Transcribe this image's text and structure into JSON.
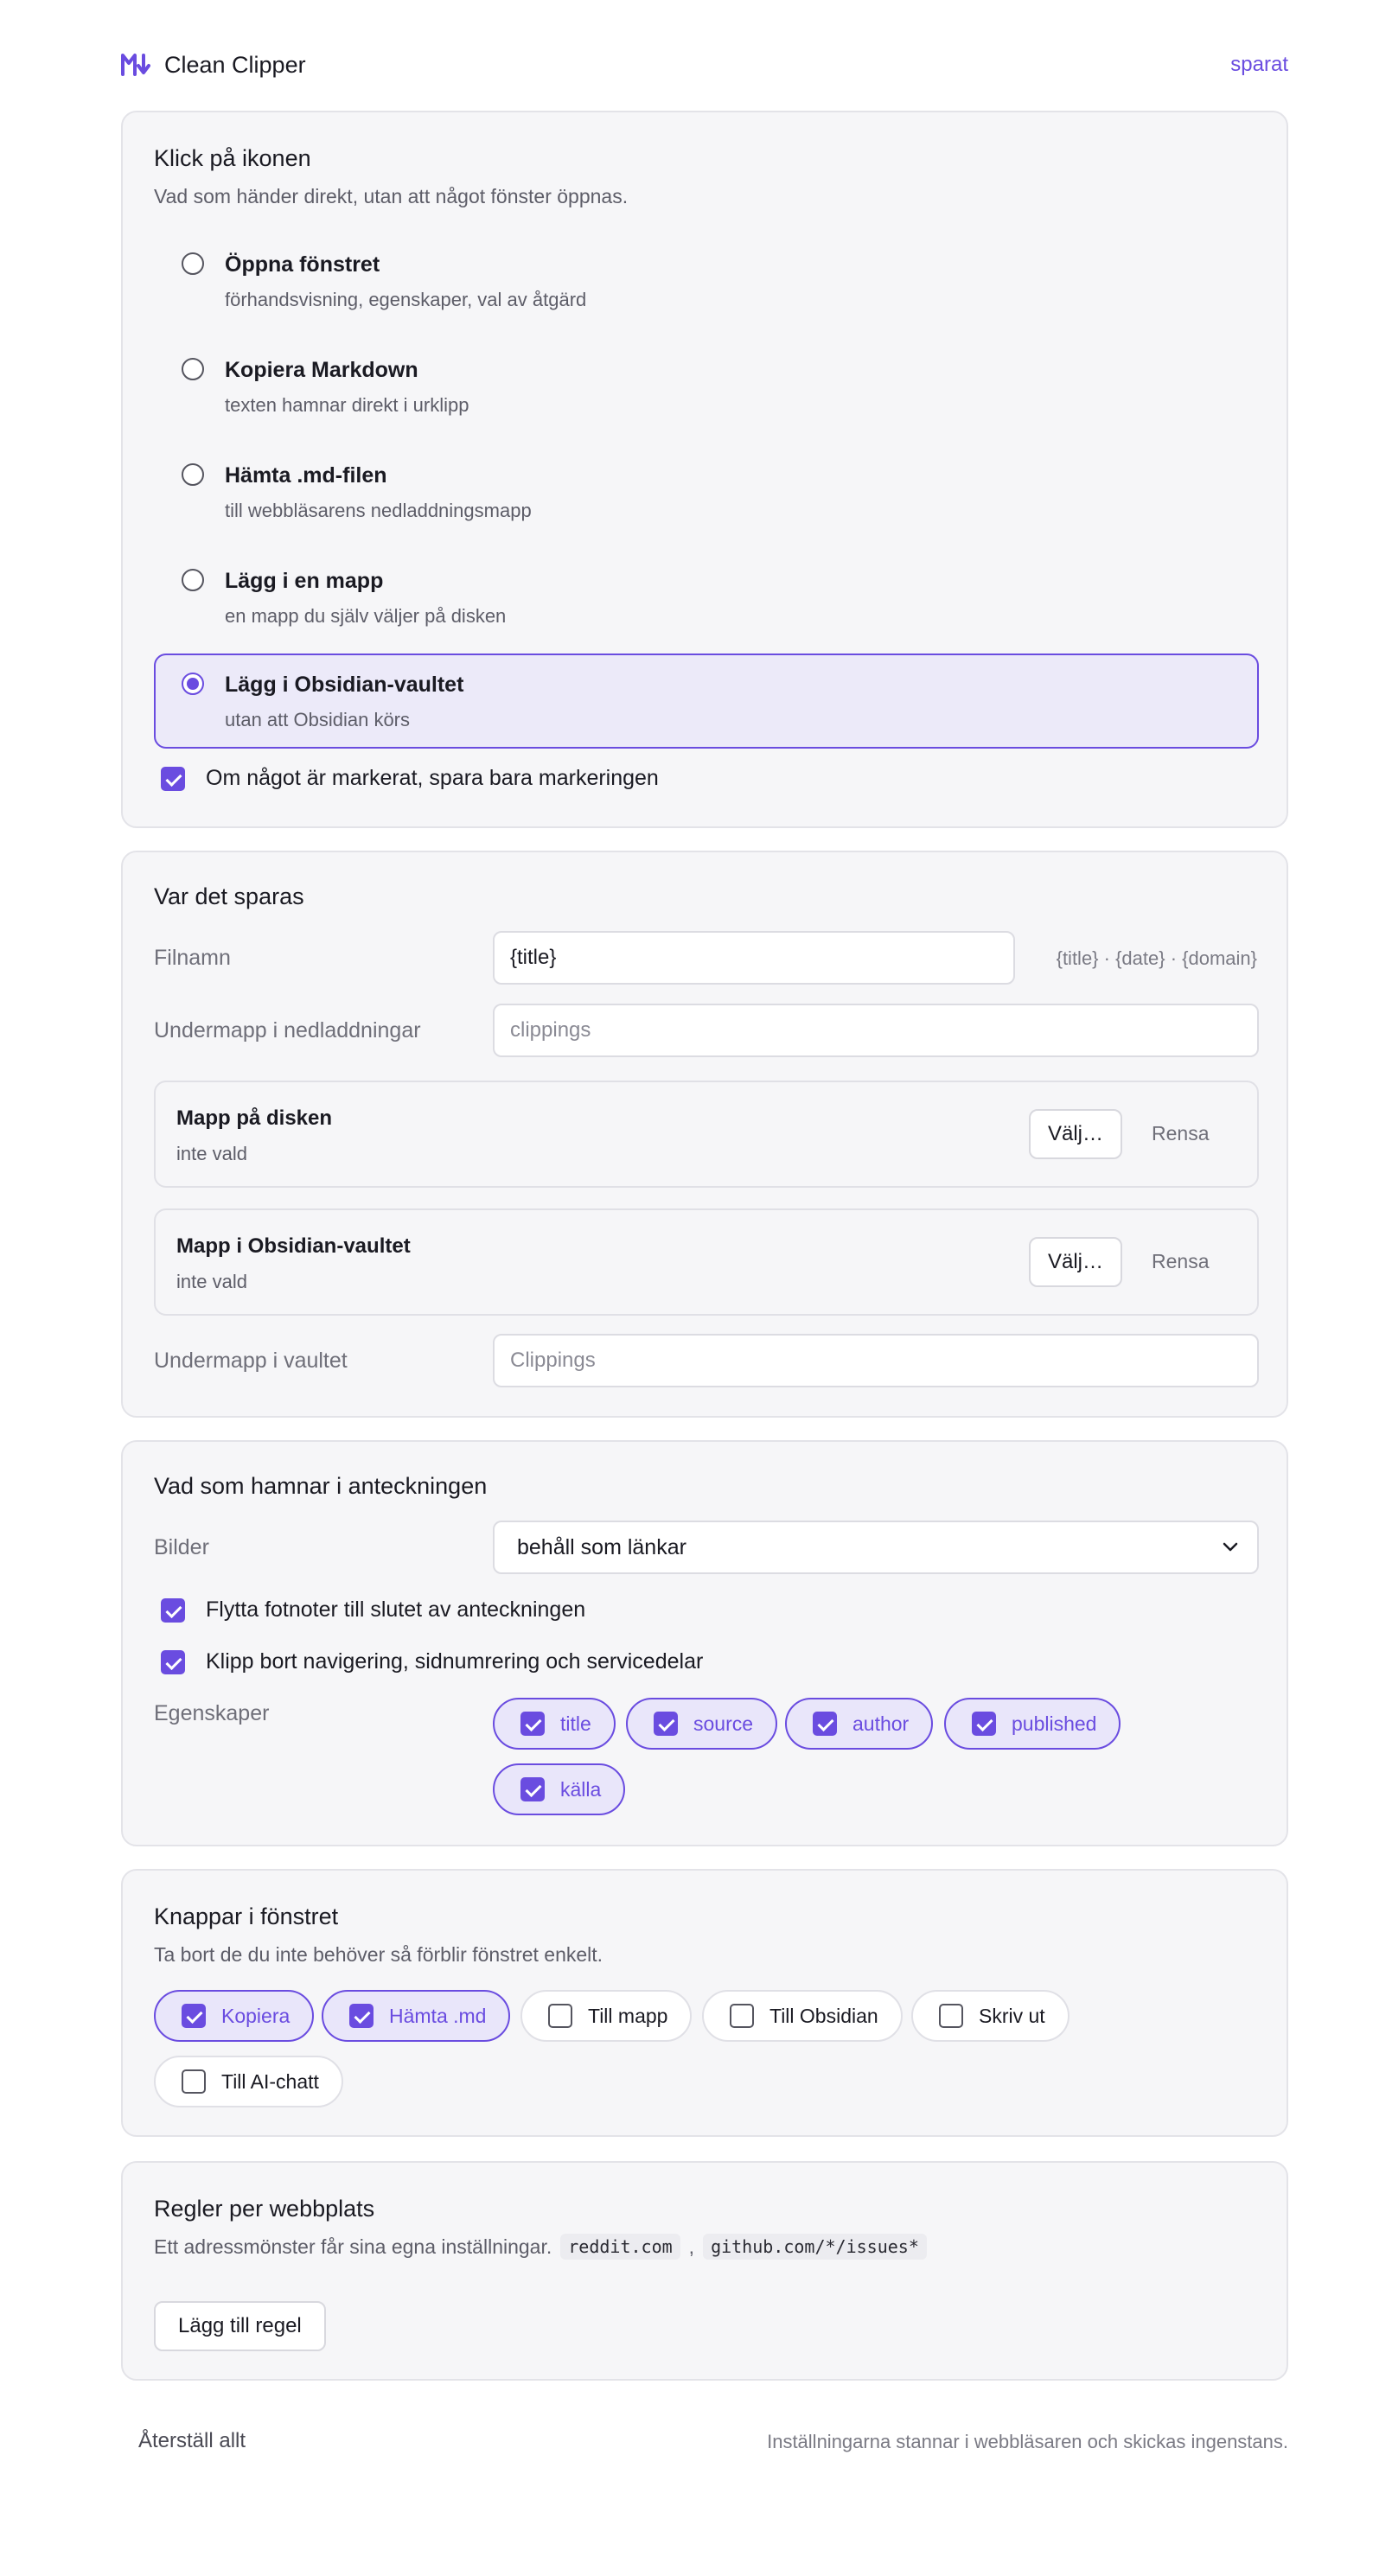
{
  "app": {
    "title": "Clean Clipper",
    "status": "sparat",
    "accent_color": "#6a4ce0"
  },
  "click_section": {
    "title": "Klick på ikonen",
    "description": "Vad som händer direkt, utan att något fönster öppnas.",
    "options": [
      {
        "label": "Öppna fönstret",
        "sub": "förhandsvisning, egenskaper, val av åtgärd",
        "selected": false
      },
      {
        "label": "Kopiera Markdown",
        "sub": "texten hamnar direkt i urklipp",
        "selected": false
      },
      {
        "label": "Hämta .md-filen",
        "sub": "till webbläsarens nedladdningsmapp",
        "selected": false
      },
      {
        "label": "Lägg i en mapp",
        "sub": "en mapp du själv väljer på disken",
        "selected": false
      },
      {
        "label": "Lägg i Obsidian-vaultet",
        "sub": "utan att Obsidian körs",
        "selected": true
      }
    ],
    "selection_only": {
      "label": "Om något är markerat, spara bara markeringen",
      "checked": true
    }
  },
  "save_section": {
    "title": "Var det sparas",
    "filename": {
      "label": "Filnamn",
      "value": "{title}",
      "hint": "{title} · {date} · {domain}"
    },
    "download_subfolder": {
      "label": "Undermapp i nedladdningar",
      "placeholder": "clippings"
    },
    "disk_folder": {
      "title": "Mapp på disken",
      "value": "inte vald",
      "choose": "Välj…",
      "clear": "Rensa"
    },
    "vault_folder": {
      "title": "Mapp i Obsidian-vaultet",
      "value": "inte vald",
      "choose": "Välj…",
      "clear": "Rensa"
    },
    "vault_subfolder": {
      "label": "Undermapp i vaultet",
      "placeholder": "Clippings"
    }
  },
  "note_section": {
    "title": "Vad som hamnar i anteckningen",
    "images": {
      "label": "Bilder",
      "value": "behåll som länkar"
    },
    "footnotes": {
      "label": "Flytta fotnoter till slutet av anteckningen",
      "checked": true
    },
    "strip_nav": {
      "label": "Klipp bort navigering, sidnumrering och servicedelar",
      "checked": true
    },
    "properties_label": "Egenskaper",
    "properties": [
      {
        "label": "title",
        "checked": true
      },
      {
        "label": "source",
        "checked": true
      },
      {
        "label": "author",
        "checked": true
      },
      {
        "label": "published",
        "checked": true
      },
      {
        "label": "källa",
        "checked": true
      }
    ]
  },
  "buttons_section": {
    "title": "Knappar i fönstret",
    "description": "Ta bort de du inte behöver så förblir fönstret enkelt.",
    "buttons": [
      {
        "label": "Kopiera",
        "checked": true
      },
      {
        "label": "Hämta .md",
        "checked": true
      },
      {
        "label": "Till mapp",
        "checked": false
      },
      {
        "label": "Till Obsidian",
        "checked": false
      },
      {
        "label": "Skriv ut",
        "checked": false
      },
      {
        "label": "Till AI-chatt",
        "checked": false
      }
    ]
  },
  "rules_section": {
    "title": "Regler per webbplats",
    "description": "Ett adressmönster får sina egna inställningar.",
    "example_1": "reddit.com",
    "separator": ",",
    "example_2": "github.com/*/issues*",
    "add_rule": "Lägg till regel"
  },
  "footer": {
    "reset": "Återställ allt",
    "note": "Inställningarna stannar i webbläsaren och skickas ingenstans."
  }
}
